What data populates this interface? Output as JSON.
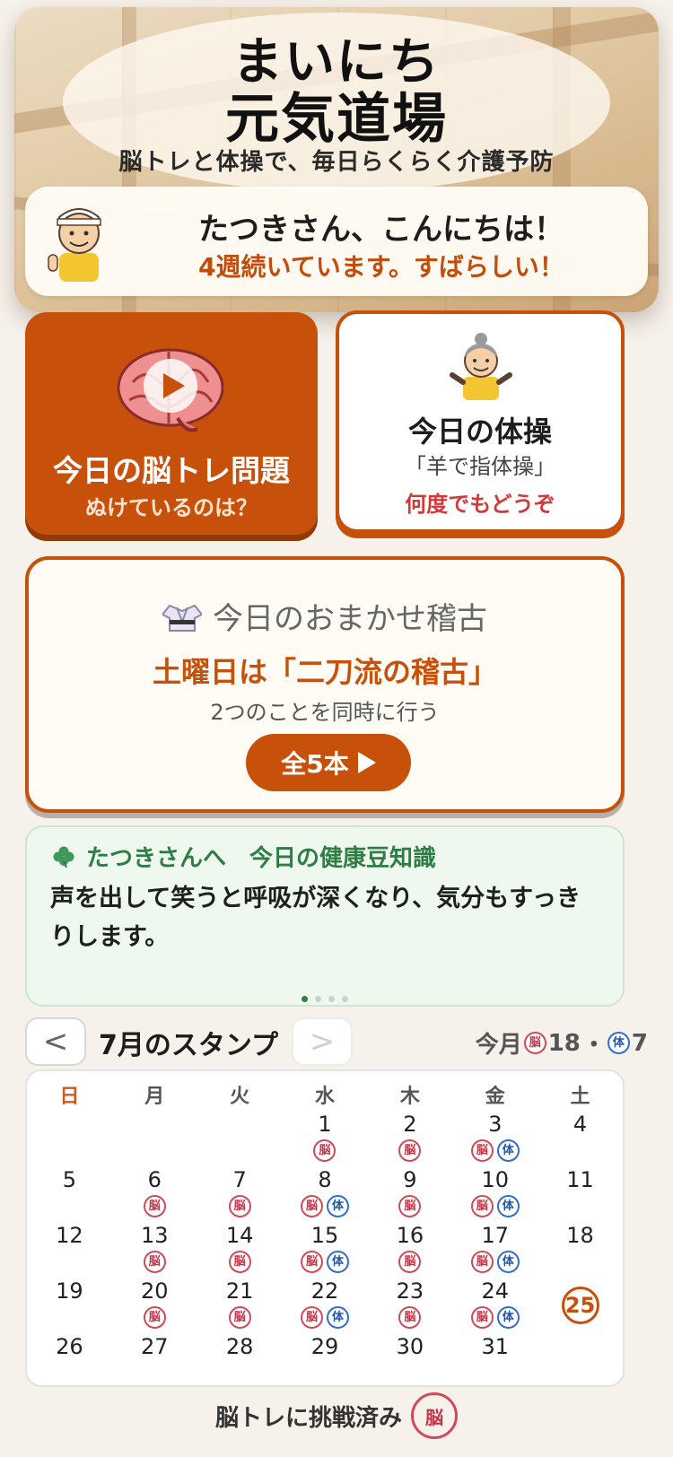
{
  "hero": {
    "logo_line1": "まいにち",
    "logo_line2": "元気道場",
    "subtitle": "脳トレと体操で、毎日らくらく介護予防",
    "greeting": "たつきさん、こんにちは！",
    "streak": "4週続いています。すばらしい！"
  },
  "brain_card": {
    "title": "今日の脳トレ問題",
    "subtitle": "ぬけているのは？"
  },
  "exercise_card": {
    "title": "今日の体操",
    "subtitle": "「羊で指体操」",
    "note": "何度でもどうぞ"
  },
  "omakase": {
    "heading": "今日のおまかせ稽古",
    "theme": "土曜日は「二刀流の稽古」",
    "description": "2つのことを同時に行う",
    "button_label": "全5本"
  },
  "tip": {
    "heading": "たつきさんへ　今日の健康豆知識",
    "body": "声を出して笑うと呼吸が深くなり、気分もすっきりします。",
    "pages": 4,
    "active_page": 1
  },
  "stamps": {
    "prev_label": "<",
    "next_label": ">",
    "title": "7月のスタンプ",
    "count_prefix": "今月",
    "brain_count": "18",
    "separator": "・",
    "body_count": "7",
    "brain_mark": "脳",
    "body_mark": "体"
  },
  "calendar": {
    "weekdays": [
      "日",
      "月",
      "火",
      "水",
      "木",
      "金",
      "土"
    ],
    "today": 25,
    "weeks": [
      [
        null,
        null,
        null,
        {
          "d": 1,
          "m": [
            "脳"
          ]
        },
        {
          "d": 2,
          "m": [
            "脳"
          ]
        },
        {
          "d": 3,
          "m": [
            "脳",
            "体"
          ]
        },
        {
          "d": 4,
          "m": []
        }
      ],
      [
        {
          "d": 5,
          "m": []
        },
        {
          "d": 6,
          "m": [
            "脳"
          ]
        },
        {
          "d": 7,
          "m": [
            "脳"
          ]
        },
        {
          "d": 8,
          "m": [
            "脳",
            "体"
          ]
        },
        {
          "d": 9,
          "m": [
            "脳"
          ]
        },
        {
          "d": 10,
          "m": [
            "脳",
            "体"
          ]
        },
        {
          "d": 11,
          "m": []
        }
      ],
      [
        {
          "d": 12,
          "m": []
        },
        {
          "d": 13,
          "m": [
            "脳"
          ]
        },
        {
          "d": 14,
          "m": [
            "脳"
          ]
        },
        {
          "d": 15,
          "m": [
            "脳",
            "体"
          ]
        },
        {
          "d": 16,
          "m": [
            "脳"
          ]
        },
        {
          "d": 17,
          "m": [
            "脳",
            "体"
          ]
        },
        {
          "d": 18,
          "m": []
        }
      ],
      [
        {
          "d": 19,
          "m": []
        },
        {
          "d": 20,
          "m": [
            "脳"
          ]
        },
        {
          "d": 21,
          "m": [
            "脳"
          ]
        },
        {
          "d": 22,
          "m": [
            "脳",
            "体"
          ]
        },
        {
          "d": 23,
          "m": [
            "脳"
          ]
        },
        {
          "d": 24,
          "m": [
            "脳",
            "体"
          ]
        },
        {
          "d": 25,
          "m": []
        }
      ],
      [
        {
          "d": 26,
          "m": []
        },
        {
          "d": 27,
          "m": []
        },
        {
          "d": 28,
          "m": []
        },
        {
          "d": 29,
          "m": []
        },
        {
          "d": 30,
          "m": []
        },
        {
          "d": 31,
          "m": []
        },
        null
      ]
    ]
  },
  "teaser": {
    "text": "脳トレに挑戦済み",
    "stamp": "脳"
  },
  "colors": {
    "accent": "#c7510b",
    "brain_stamp": "#d14a5a",
    "body_stamp": "#2f6fd0",
    "tip_green": "#2f7d45"
  }
}
